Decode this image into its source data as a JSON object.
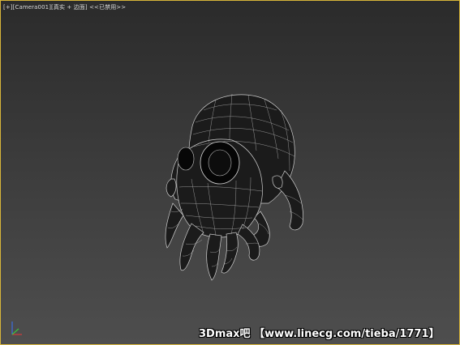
{
  "viewport": {
    "label_plus": "[+]",
    "label_camera": "[Camera001]",
    "label_shading": "[真实 + 边面]",
    "label_disabled": "<<已禁用>>",
    "border_color": "#d7b53a"
  },
  "model": {
    "icon": "octopus-skull-wireframe-icon"
  },
  "gizmo": {
    "icon": "axis-tripod-icon",
    "colors": {
      "x": "#d23c3c",
      "y": "#3cc23c",
      "z": "#3c6fe0"
    }
  },
  "watermark": {
    "text": "3Dmax吧 【www.linecg.com/tieba/1771】"
  }
}
